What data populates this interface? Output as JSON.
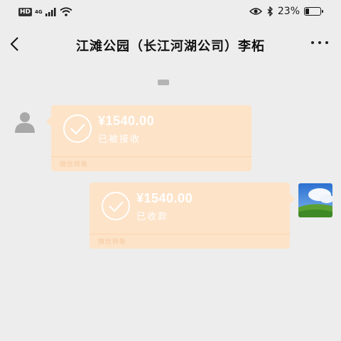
{
  "status_bar": {
    "hd": "HD",
    "network": "4G",
    "battery": "23%",
    "battery_level": 0.23
  },
  "nav": {
    "title": "江滩公园（长江河湖公司）李柘"
  },
  "messages": [
    {
      "amount": "¥1540.00",
      "status": "已被接收",
      "footer": "微信转账"
    },
    {
      "amount": "¥1540.00",
      "status": "已收款",
      "footer": "微信转账"
    }
  ],
  "colors": {
    "background": "#ededed",
    "bubble": "#fde3c8",
    "text_on_bubble": "#ffffff"
  }
}
